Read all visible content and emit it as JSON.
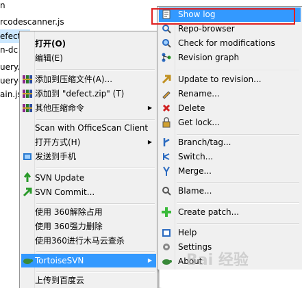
{
  "files": [
    {
      "label": "n"
    },
    {
      "label": "rcodescanner.js"
    },
    {
      "label": "efect.js"
    },
    {
      "label": "n-dc"
    },
    {
      "label": "uery."
    },
    {
      "label": "uery-"
    },
    {
      "label": "ain.js"
    }
  ],
  "main_menu": {
    "items": [
      {
        "label": "打开(O)",
        "icon": "none"
      },
      {
        "label": "编辑(E)",
        "icon": "none"
      },
      {
        "label": "添加到压缩文件(A)...",
        "icon": "winrar-icon"
      },
      {
        "label": "添加到 \"defect.zip\" (T)",
        "icon": "winrar-icon"
      },
      {
        "label": "其他压缩命令",
        "icon": "winrar-icon"
      },
      {
        "label": "Scan with OfficeScan Client",
        "icon": "none"
      },
      {
        "label": "打开方式(H)",
        "icon": "none"
      },
      {
        "label": "发送到手机",
        "icon": "phone-icon"
      },
      {
        "label": "SVN Update",
        "icon": "svn-update-icon"
      },
      {
        "label": "SVN Commit...",
        "icon": "svn-commit-icon"
      },
      {
        "label": "使用 360解除占用",
        "icon": "none"
      },
      {
        "label": "使用 360强力删除",
        "icon": "none"
      },
      {
        "label": "使用360进行木马云查杀",
        "icon": "none"
      },
      {
        "label": "TortoiseSVN",
        "icon": "tortoise-icon"
      },
      {
        "label": "上传到百度云",
        "icon": "none"
      }
    ]
  },
  "svn_menu": {
    "items": [
      {
        "label": "Show log",
        "icon": "log-icon"
      },
      {
        "label": "Repo-browser",
        "icon": "repo-browser-icon"
      },
      {
        "label": "Check for modifications",
        "icon": "check-modifications-icon"
      },
      {
        "label": "Revision graph",
        "icon": "revision-graph-icon"
      },
      {
        "label": "Update to revision...",
        "icon": "update-revision-icon"
      },
      {
        "label": "Rename...",
        "icon": "rename-icon"
      },
      {
        "label": "Delete",
        "icon": "delete-icon"
      },
      {
        "label": "Get lock...",
        "icon": "lock-icon"
      },
      {
        "label": "Branch/tag...",
        "icon": "branch-icon"
      },
      {
        "label": "Switch...",
        "icon": "switch-icon"
      },
      {
        "label": "Merge...",
        "icon": "merge-icon"
      },
      {
        "label": "Blame...",
        "icon": "blame-icon"
      },
      {
        "label": "Create patch...",
        "icon": "patch-icon"
      },
      {
        "label": "Help",
        "icon": "help-icon"
      },
      {
        "label": "Settings",
        "icon": "settings-icon"
      },
      {
        "label": "About",
        "icon": "about-icon"
      }
    ]
  },
  "watermark": "Bai 经验"
}
